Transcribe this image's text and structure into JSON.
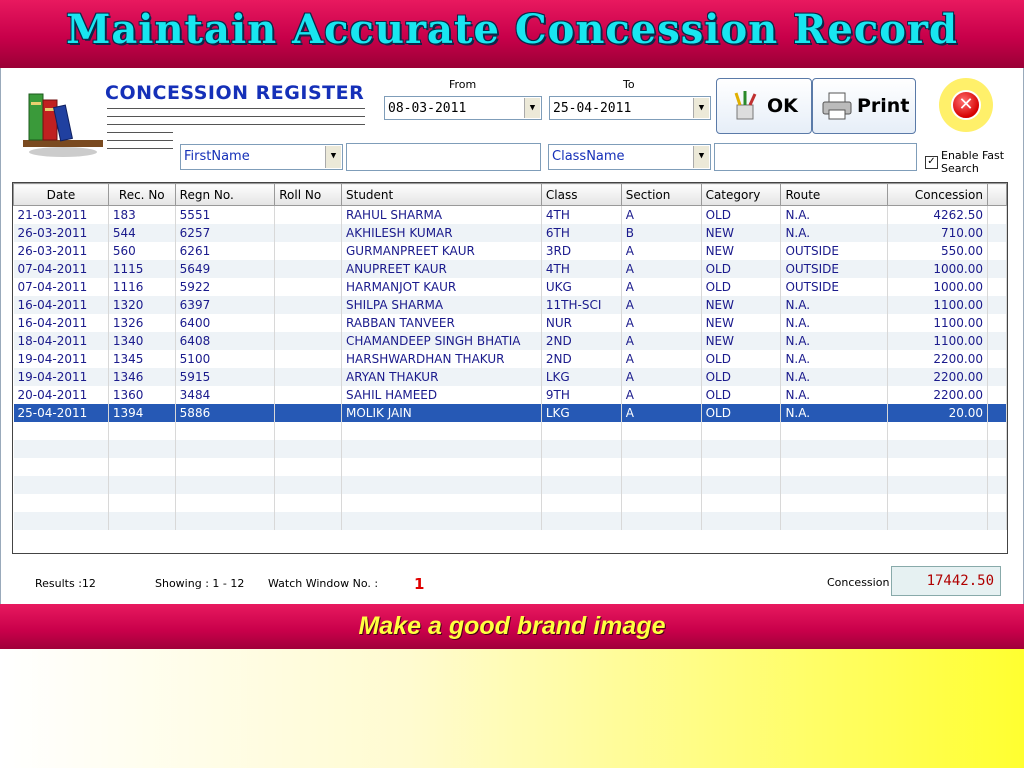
{
  "banner": {
    "title": "Maintain Accurate Concession Record"
  },
  "register": {
    "title": "CONCESSION REGISTER",
    "from_label": "From",
    "to_label": "To",
    "from_date": "08-03-2011",
    "to_date": "25-04-2011",
    "ok_label": "OK",
    "print_label": "Print",
    "filter1_field": "FirstName",
    "filter2_field": "ClassName",
    "filter1_value": "",
    "filter2_value": "",
    "fast_search_line1": "Enable Fast",
    "fast_search_line2": "Search",
    "fast_search_checked": true
  },
  "table": {
    "columns": [
      "Date",
      "Rec. No",
      "Regn No.",
      "Roll No",
      "Student",
      "Class",
      "Section",
      "Category",
      "Route",
      "Concession"
    ],
    "rows": [
      [
        "21-03-2011",
        "183",
        "5551",
        "",
        "RAHUL SHARMA",
        "4TH",
        "A",
        "OLD",
        "N.A.",
        "4262.50"
      ],
      [
        "26-03-2011",
        "544",
        "6257",
        "",
        "AKHILESH KUMAR",
        "6TH",
        "B",
        "NEW",
        "N.A.",
        "710.00"
      ],
      [
        "26-03-2011",
        "560",
        "6261",
        "",
        "GURMANPREET KAUR",
        "3RD",
        "A",
        "NEW",
        "OUTSIDE",
        "550.00"
      ],
      [
        "07-04-2011",
        "1115",
        "5649",
        "",
        "ANUPREET KAUR",
        "4TH",
        "A",
        "OLD",
        "OUTSIDE",
        "1000.00"
      ],
      [
        "07-04-2011",
        "1116",
        "5922",
        "",
        "HARMANJOT KAUR",
        "UKG",
        "A",
        "OLD",
        "OUTSIDE",
        "1000.00"
      ],
      [
        "16-04-2011",
        "1320",
        "6397",
        "",
        "SHILPA SHARMA",
        "11TH-SCI",
        "A",
        "NEW",
        "N.A.",
        "1100.00"
      ],
      [
        "16-04-2011",
        "1326",
        "6400",
        "",
        "RABBAN TANVEER",
        "NUR",
        "A",
        "NEW",
        "N.A.",
        "1100.00"
      ],
      [
        "18-04-2011",
        "1340",
        "6408",
        "",
        "CHAMANDEEP SINGH BHATIA",
        "2ND",
        "A",
        "NEW",
        "N.A.",
        "1100.00"
      ],
      [
        "19-04-2011",
        "1345",
        "5100",
        "",
        "HARSHWARDHAN THAKUR",
        "2ND",
        "A",
        "OLD",
        "N.A.",
        "2200.00"
      ],
      [
        "19-04-2011",
        "1346",
        "5915",
        "",
        "ARYAN THAKUR",
        "LKG",
        "A",
        "OLD",
        "N.A.",
        "2200.00"
      ],
      [
        "20-04-2011",
        "1360",
        "3484",
        "",
        "SAHIL HAMEED",
        "9TH",
        "A",
        "OLD",
        "N.A.",
        "2200.00"
      ],
      [
        "25-04-2011",
        "1394",
        "5886",
        "",
        "MOLIK JAIN",
        "LKG",
        "A",
        "OLD",
        "N.A.",
        "20.00"
      ]
    ],
    "selected_row": 11,
    "empty_rows": 6
  },
  "status": {
    "results": "Results :12",
    "showing": "Showing :  1 - 12",
    "watch_window_label": "Watch Window No. :",
    "watch_window_no": "1",
    "concession_label": "Concession",
    "concession_total": "17442.50"
  },
  "tagline": "Make a good brand image",
  "colors": {
    "banner": "#c8004a",
    "title_text": "#18e6f0",
    "tagline_text": "#ffff40",
    "selected_row": "#2659b5"
  }
}
